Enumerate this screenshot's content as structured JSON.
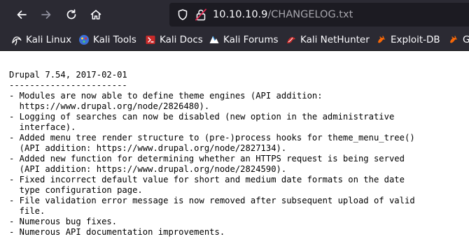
{
  "colors": {
    "toolbar_bg": "#2b2a33",
    "urlbar_bg": "#1c1b22",
    "icon_fg": "#fbfbfe",
    "lock_warning": "#e22850",
    "page_bg": "#ffffff"
  },
  "toolbar": {
    "back_icon": "arrow-left-icon",
    "forward_icon": "arrow-right-icon",
    "reload_icon": "reload-icon",
    "home_icon": "home-icon"
  },
  "urlbar": {
    "host": "10.10.10.9",
    "path": "/CHANGELOG.txt"
  },
  "bookmarks": [
    {
      "label": "Kali Linux",
      "icon": "kali-dragon-icon"
    },
    {
      "label": "Kali Tools",
      "icon": "kali-tools-icon"
    },
    {
      "label": "Kali Docs",
      "icon": "kali-docs-icon"
    },
    {
      "label": "Kali Forums",
      "icon": "kali-forums-icon"
    },
    {
      "label": "Kali NetHunter",
      "icon": "kali-nethunter-icon"
    },
    {
      "label": "Exploit-DB",
      "icon": "exploit-db-icon"
    },
    {
      "label": "G",
      "icon": "exploit-db-icon"
    }
  ],
  "document": {
    "lines": [
      "Drupal 7.54, 2017-02-01",
      "-----------------------",
      "- Modules are now able to define theme engines (API addition:",
      "  https://www.drupal.org/node/2826480).",
      "- Logging of searches can now be disabled (new option in the administrative",
      "  interface).",
      "- Added menu tree render structure to (pre-)process hooks for theme_menu_tree()",
      "  (API addition: https://www.drupal.org/node/2827134).",
      "- Added new function for determining whether an HTTPS request is being served",
      "  (API addition: https://www.drupal.org/node/2824590).",
      "- Fixed incorrect default value for short and medium date formats on the date",
      "  type configuration page.",
      "- File validation error message is now removed after subsequent upload of valid",
      "  file.",
      "- Numerous bug fixes.",
      "- Numerous API documentation improvements."
    ]
  }
}
